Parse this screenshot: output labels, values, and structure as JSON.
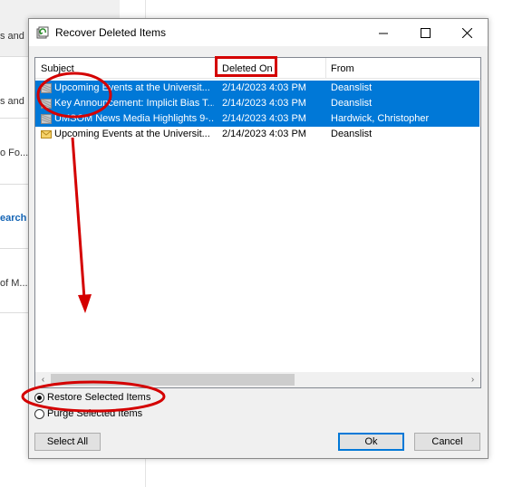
{
  "background": {
    "fragments": [
      "s and",
      "s and",
      "o Fo...",
      "earch",
      "of M..."
    ]
  },
  "dialog": {
    "title": "Recover Deleted Items",
    "controls": {
      "minimize": "—",
      "maximize": "☐",
      "close": "✕"
    }
  },
  "list": {
    "columns": [
      "Subject",
      "Deleted On",
      "From"
    ],
    "rows": [
      {
        "subject": "Upcoming Events at the Universit...",
        "deleted_on": "2/14/2023 4:03 PM",
        "from": "Deanslist",
        "selected": true
      },
      {
        "subject": "Key Announcement: Implicit Bias T...",
        "deleted_on": "2/14/2023 4:03 PM",
        "from": "Deanslist",
        "selected": true
      },
      {
        "subject": "UMSOM News Media Highlights 9-...",
        "deleted_on": "2/14/2023 4:03 PM",
        "from": "Hardwick, Christopher",
        "selected": true
      },
      {
        "subject": "Upcoming Events at the Universit...",
        "deleted_on": "2/14/2023 4:03 PM",
        "from": "Deanslist",
        "selected": false
      }
    ]
  },
  "options": {
    "restore_label": "Restore Selected Items",
    "purge_label": "Purge Selected Items",
    "selected": "restore"
  },
  "buttons": {
    "select_all": "Select All",
    "ok": "Ok",
    "cancel": "Cancel"
  },
  "colors": {
    "selection": "#0078d7",
    "annotation": "#d40000"
  }
}
